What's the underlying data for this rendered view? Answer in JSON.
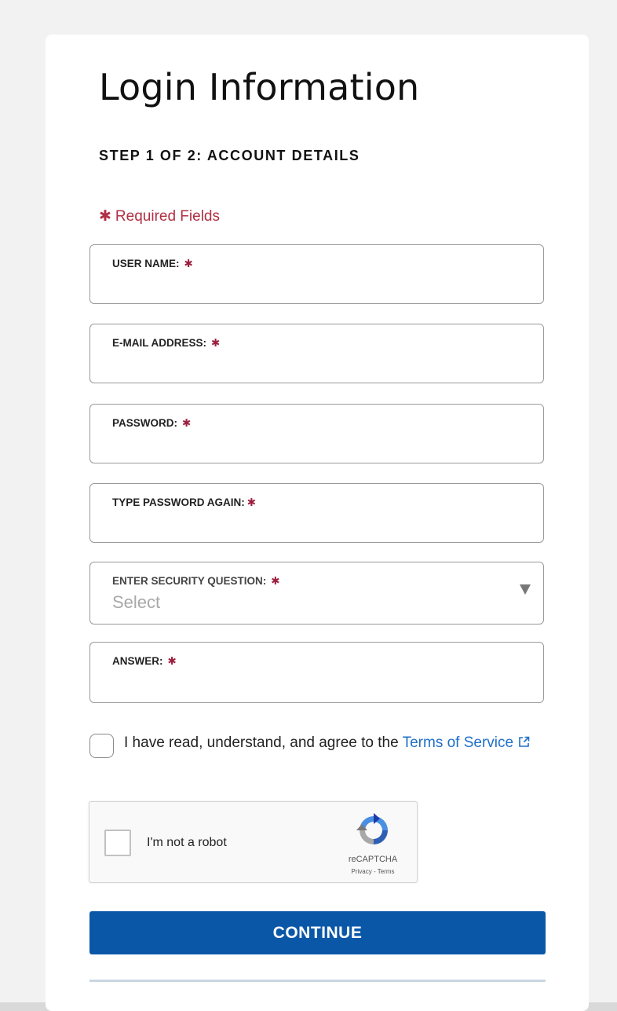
{
  "page": {
    "title": "Login Information",
    "step": "STEP 1 OF 2: ACCOUNT DETAILS",
    "required_note": "Required Fields",
    "asterisk": "✱"
  },
  "fields": {
    "username": {
      "label": "USER NAME:",
      "value": ""
    },
    "email": {
      "label": "E-MAIL ADDRESS:",
      "value": ""
    },
    "password": {
      "label": "PASSWORD:",
      "value": ""
    },
    "password_again": {
      "label": "TYPE PASSWORD AGAIN:",
      "value": ""
    },
    "security_question": {
      "label": "ENTER SECURITY QUESTION:",
      "selected": "Select"
    },
    "answer": {
      "label": "ANSWER:",
      "value": ""
    }
  },
  "terms": {
    "text": "I have read, understand, and agree to the ",
    "link": "Terms of Service",
    "checked": false
  },
  "captcha": {
    "label": "I'm not a robot",
    "brand": "reCAPTCHA",
    "links": "Privacy - Terms",
    "checked": false
  },
  "actions": {
    "continue_label": "CONTINUE"
  },
  "colors": {
    "primary": "#0a57a8",
    "required": "#b03045",
    "link": "#1f6fc9"
  }
}
